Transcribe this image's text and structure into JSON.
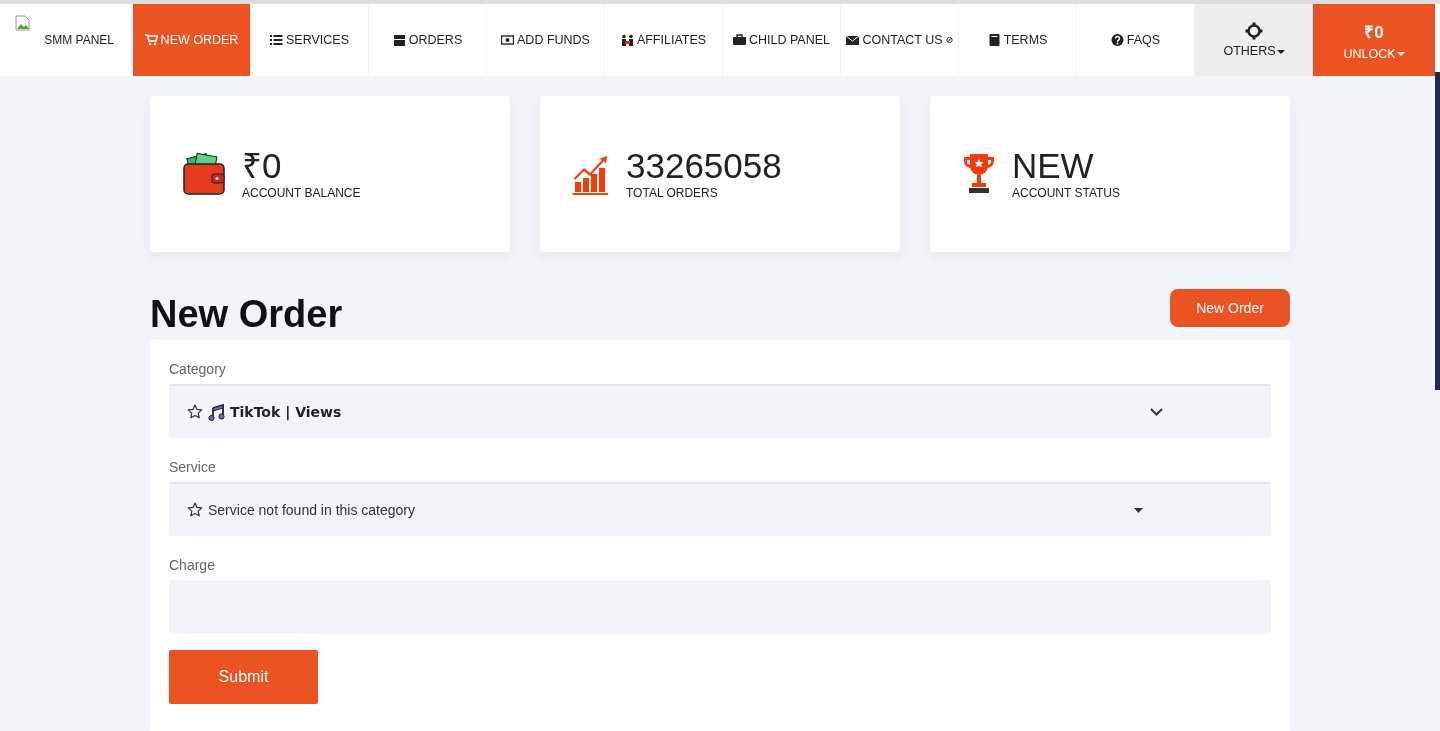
{
  "brand": {
    "label": "SMM PANEL"
  },
  "nav": [
    {
      "label": "NEW ORDER",
      "selected": true
    },
    {
      "label": "SERVICES",
      "selected": false
    },
    {
      "label": "ORDERS",
      "selected": false
    },
    {
      "label": "ADD FUNDS",
      "selected": false
    },
    {
      "label": "AFFILIATES",
      "selected": false
    },
    {
      "label": "CHILD PANEL",
      "selected": false
    },
    {
      "label": "CONTACT US",
      "selected": false
    },
    {
      "label": "TERMS",
      "selected": false
    },
    {
      "label": "FAQS",
      "selected": false
    }
  ],
  "others": {
    "label": "OTHERS"
  },
  "balance_menu": {
    "amount": "₹0",
    "label": "UNLOCK"
  },
  "stats": [
    {
      "value": "₹0",
      "label": "ACCOUNT BALANCE"
    },
    {
      "value": "33265058",
      "label": "TOTAL ORDERS"
    },
    {
      "value": "NEW",
      "label": "ACCOUNT STATUS"
    }
  ],
  "heading": "New Order",
  "header_button": "New Order",
  "form": {
    "category": {
      "label": "Category",
      "value": "TikTok | Views"
    },
    "service": {
      "label": "Service",
      "value": "Service not found in this category"
    },
    "charge": {
      "label": "Charge"
    },
    "submit": "Submit"
  }
}
